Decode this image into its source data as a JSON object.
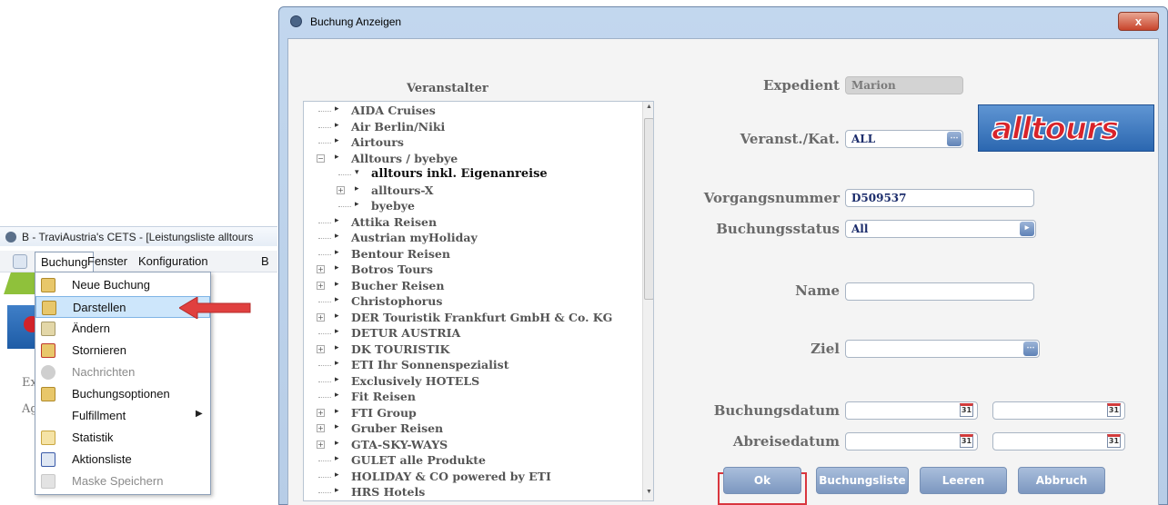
{
  "left_app": {
    "title": "B - TraviAustria's CETS - [Leistungsliste alltours",
    "menu": [
      "Buchung",
      "Fenster",
      "Konfiguration",
      "B"
    ],
    "ghost_texts": [
      "Ex",
      "Ag"
    ],
    "buchung_menu": [
      {
        "label": "Neue Buchung",
        "icon": "new-booking-icon"
      },
      {
        "label": "Darstellen",
        "icon": "display-icon",
        "highlighted": true
      },
      {
        "label": "Ändern",
        "icon": "edit-icon"
      },
      {
        "label": "Stornieren",
        "icon": "cancel-booking-icon"
      },
      {
        "label": "Nachrichten",
        "icon": "messages-icon",
        "disabled": true
      },
      {
        "label": "Buchungsoptionen",
        "icon": "booking-options-icon"
      },
      {
        "label": "Fulfillment",
        "icon": "none",
        "submenu": true
      },
      {
        "label": "Statistik",
        "icon": "statistics-icon"
      },
      {
        "label": "Aktionsliste",
        "icon": "action-list-icon"
      },
      {
        "label": "Maske Speichern",
        "icon": "save-mask-icon",
        "disabled": true
      }
    ]
  },
  "dialog": {
    "title": "Buchung Anzeigen",
    "close_label": "x",
    "veranstalter_header": "Veranstalter",
    "tree": [
      {
        "label": "AIDA Cruises",
        "level": 0
      },
      {
        "label": "Air Berlin/Niki",
        "level": 0
      },
      {
        "label": "Airtours",
        "level": 0
      },
      {
        "label": "Alltours / byebye",
        "level": 0,
        "expanded": true
      },
      {
        "label": "alltours inkl. Eigenanreise",
        "level": 1,
        "selected": true
      },
      {
        "label": "alltours-X",
        "level": 1,
        "plus": true
      },
      {
        "label": "byebye",
        "level": 1
      },
      {
        "label": "Attika Reisen",
        "level": 0
      },
      {
        "label": "Austrian myHoliday",
        "level": 0
      },
      {
        "label": "Bentour Reisen",
        "level": 0
      },
      {
        "label": "Botros Tours",
        "level": 0,
        "plus": true
      },
      {
        "label": "Bucher Reisen",
        "level": 0,
        "plus": true
      },
      {
        "label": "Christophorus",
        "level": 0
      },
      {
        "label": "DER Touristik Frankfurt GmbH & Co. KG",
        "level": 0,
        "plus": true
      },
      {
        "label": "DETUR AUSTRIA",
        "level": 0
      },
      {
        "label": "DK TOURISTIK",
        "level": 0,
        "plus": true
      },
      {
        "label": "ETI Ihr Sonnenspezialist",
        "level": 0
      },
      {
        "label": "Exclusively HOTELS",
        "level": 0
      },
      {
        "label": "Fit Reisen",
        "level": 0
      },
      {
        "label": "FTI Group",
        "level": 0,
        "plus": true
      },
      {
        "label": "Gruber Reisen",
        "level": 0,
        "plus": true
      },
      {
        "label": "GTA-SKY-WAYS",
        "level": 0,
        "plus": true
      },
      {
        "label": "GULET alle Produkte",
        "level": 0
      },
      {
        "label": "HOLIDAY & CO powered by ETI",
        "level": 0
      },
      {
        "label": "HRS Hotels",
        "level": 0
      }
    ],
    "fields": {
      "expedient_label": "Expedient",
      "expedient_value": "Marion",
      "veranst_label": "Veranst./Kat.",
      "veranst_value": "ALL",
      "vorgang_label": "Vorgangsnummer",
      "vorgang_value": "D509537",
      "status_label": "Buchungsstatus",
      "status_value": "All",
      "name_label": "Name",
      "name_value": "",
      "ziel_label": "Ziel",
      "ziel_value": "",
      "buchungsdatum_label": "Buchungsdatum",
      "abreisedatum_label": "Abreisedatum",
      "cal_day": "31"
    },
    "logo_text": "alltours",
    "buttons": {
      "ok": "Ok",
      "liste": "Buchungsliste",
      "leeren": "Leeren",
      "abbruch": "Abbruch"
    }
  },
  "colors": {
    "highlight_red": "#d9363e",
    "button_blue": "#8aa4cb",
    "dialog_frame": "#bcd2ea"
  }
}
